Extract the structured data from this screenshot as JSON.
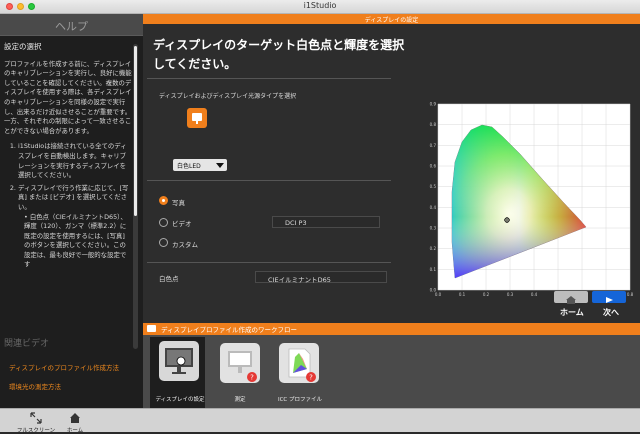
{
  "window": {
    "title": "i1Studio"
  },
  "help": {
    "header": "ヘルプ",
    "section_title": "設定の選択",
    "intro": "プロファイルを作成する前に、ディスプレイのキャリブレーションを実行し、良好に機能していることを確認してください。複数のディスプレイを使用する際は、各ディスプレイのキャリブレーションを同様の設定で実行し、出来るだけ近似させることが重要です。一方、それぞれの制限によって一致させることができない場合があります。",
    "steps": [
      "i1Studioは接続されている全てのディスプレイを自動検出します。キャリブレーションを実行するディスプレイを選択してください。",
      "ディスプレイで行う作業に応じて、[写真] または [ビデオ] を選択してください。"
    ],
    "bullet": "白色点（CIEイルミナントD65）、輝度（120）、ガンマ（標準2.2）に既定の設定を使用するには、[写真] のボタンを選択してください。この設定は、最も良好で一般的な設定です",
    "related_title": "関連ビデオ",
    "related_links": [
      "ディスプレイのプロファイル作成方法",
      "環境光の測定方法"
    ]
  },
  "main": {
    "header": "ディスプレイの設定",
    "title": "ディスプレイのターゲット白色点と輝度を選択してください。",
    "display_type_label": "ディスプレイおよびディスプレイ光源タイプを選択",
    "display_type_value": "白色LED",
    "options": [
      {
        "label": "写真",
        "selected": true
      },
      {
        "label": "ビデオ",
        "selected": false
      },
      {
        "label": "カスタム",
        "selected": false
      }
    ],
    "video_field": "DCI P3",
    "whitepoint_label": "白色点",
    "whitepoint_value": "CIEイルミナントD65",
    "home_label": "ホーム",
    "next_label": "次へ",
    "chart_ticks_x": [
      "0.0",
      "0.1",
      "0.2",
      "0.3",
      "0.4",
      "0.5",
      "0.6",
      "0.7",
      "0.8"
    ],
    "chart_ticks_y": [
      "0.0",
      "0.1",
      "0.2",
      "0.3",
      "0.4",
      "0.5",
      "0.6",
      "0.7",
      "0.8",
      "0.9"
    ]
  },
  "workflow": {
    "title": "ディスプレイプロファイル作成のワークフロー",
    "steps": [
      "ディスプレイの設定",
      "測定",
      "ICC プロファイル"
    ]
  },
  "footer": {
    "fullscreen_label": "フルスクリーン",
    "home_label": "ホーム"
  },
  "colors": {
    "accent": "#f07f1c",
    "link": "#f08a1e",
    "next_button": "#1565d8"
  }
}
